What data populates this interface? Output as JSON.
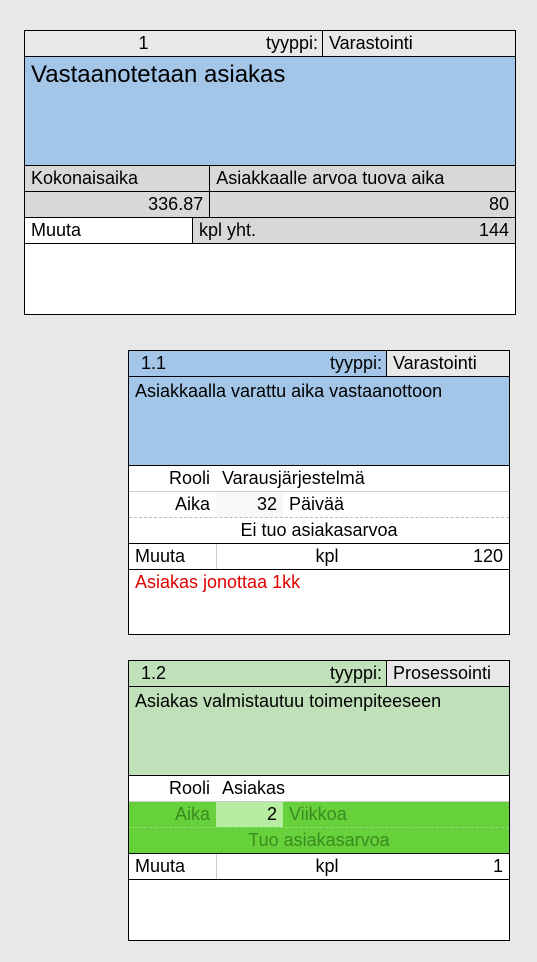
{
  "labels": {
    "tyyppi": "tyyppi:",
    "kokonaisaika": "Kokonaisaika",
    "asiakkaalle_arvoa": "Asiakkaalle arvoa tuova aika",
    "muuta": "Muuta",
    "kplyht": "kpl yht.",
    "rooli": "Rooli",
    "aika": "Aika",
    "kpl": "kpl"
  },
  "box1": {
    "id": "1",
    "type": "Varastointi",
    "title": "Vastaanotetaan asiakas",
    "kokonaisaika_value": "336.87",
    "arvoaika_value": "80",
    "kplyht_value": "144"
  },
  "box2": {
    "id": "1.1",
    "type": "Varastointi",
    "title": "Asiakkaalla varattu aika vastaanottoon",
    "rooli": "Varausjärjestelmä",
    "aika_value": "32",
    "aika_unit": "Päivää",
    "value_status": "Ei tuo asiakasarvoa",
    "kpl_value": "120",
    "note": "Asiakas jonottaa 1kk"
  },
  "box3": {
    "id": "1.2",
    "type": "Prosessointi",
    "title": "Asiakas valmistautuu toimenpiteeseen",
    "rooli": "Asiakas",
    "aika_value": "2",
    "aika_unit": "Viikkoa",
    "value_status": "Tuo asiakasarvoa",
    "kpl_value": "1"
  }
}
